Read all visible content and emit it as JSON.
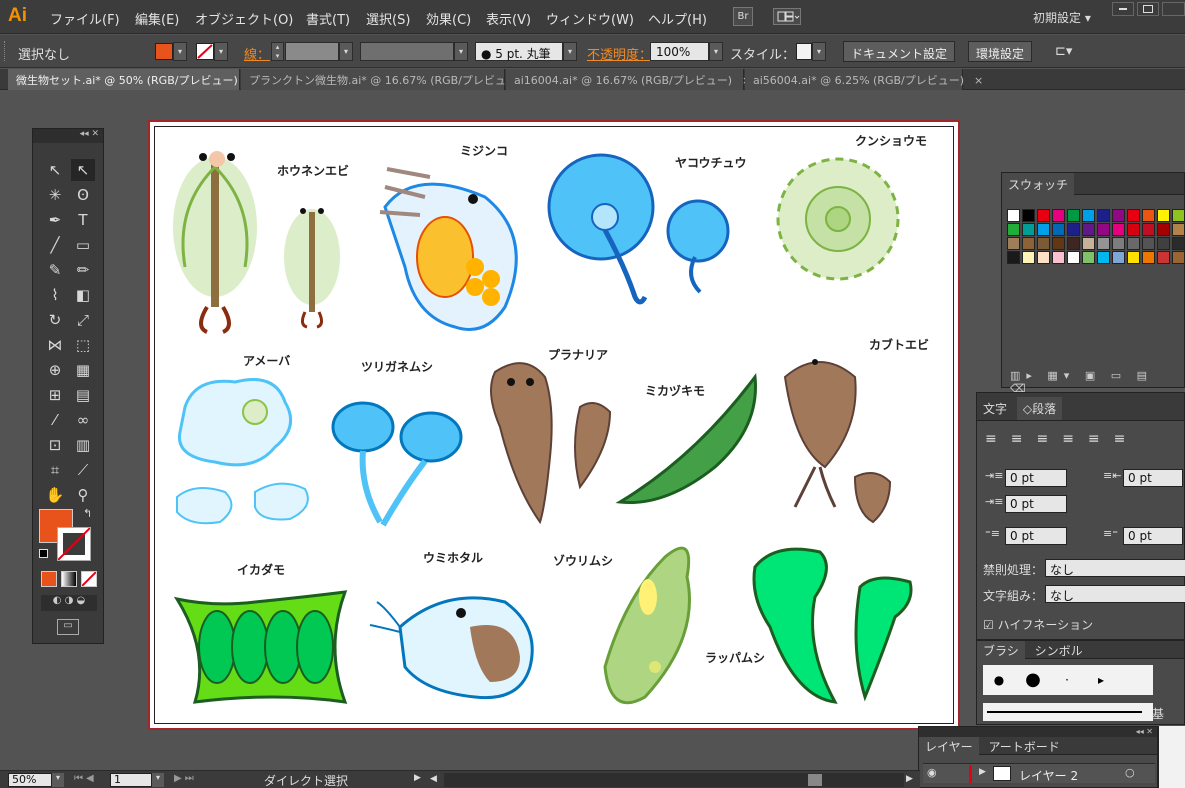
{
  "menubar": {
    "logo": "Ai",
    "items": [
      "ファイル(F)",
      "編集(E)",
      "オブジェクト(O)",
      "書式(T)",
      "選択(S)",
      "効果(C)",
      "表示(V)",
      "ウィンドウ(W)",
      "ヘルプ(H)"
    ],
    "bridge_label": "Br",
    "workspace": "初期設定"
  },
  "control": {
    "selection": "選択なし",
    "stroke_label": "線：",
    "brush": "● 5 pt. 丸筆",
    "opacity_label": "不透明度：",
    "opacity_value": "100%",
    "style_label": "スタイル：",
    "doc_settings": "ドキュメント設定",
    "prefs": "環境設定"
  },
  "tabs": [
    {
      "label": "微生物セット.ai* @ 50% (RGB/プレビュー)",
      "close": "×"
    },
    {
      "label": "プランクトン微生物.ai* @ 16.67% (RGB/プレビュー)",
      "close": "×"
    },
    {
      "label": "ai16004.ai* @ 16.67% (RGB/プレビュー)",
      "close": "×"
    },
    {
      "label": "ai56004.ai* @ 6.25% (RGB/プレビュー)",
      "close": "×"
    }
  ],
  "artboard_labels": {
    "houneneb": "ホウネンエビ",
    "mijinko": "ミジンコ",
    "yakouchu": "ヤコウチュウ",
    "kunshoumo": "クンショウモ",
    "ameba": "アメーバ",
    "tsuriganemushi": "ツリガネムシ",
    "planaria": "プラナリア",
    "mikazukimo": "ミカヅキモ",
    "kabutoebi": "カブトエビ",
    "ikadamo": "イカダモ",
    "umihotaru": "ウミホタル",
    "zourimushi": "ゾウリムシ",
    "rappamushi": "ラッパムシ"
  },
  "swatch_panel": {
    "title": "スウォッチ",
    "colors": [
      "#ffffff",
      "#000000",
      "#e60012",
      "#e4007f",
      "#009944",
      "#00a0e9",
      "#1d2088",
      "#920783",
      "#e60012",
      "#ea5514",
      "#fff100",
      "#8fc31f",
      "#22ac38",
      "#009e96",
      "#00a0e9",
      "#0068b7",
      "#1d2088",
      "#601986",
      "#920783",
      "#e4007f",
      "#d7000f",
      "#c30d23",
      "#a40000",
      "#b28247",
      "#9e7e5a",
      "#8c6239",
      "#7d5a36",
      "#603813",
      "#3e2723",
      "#c7b299",
      "#949494",
      "#7d7d7d",
      "#696969",
      "#545454",
      "#404040",
      "#2b2b2b",
      "#1a1a1a",
      "#fff3b8",
      "#fde0c5",
      "#f9c1cf",
      "#ffffff",
      "#80c269",
      "#00b7ee",
      "#7fa7d4",
      "#ffe000",
      "#ee7700",
      "#cc3333",
      "#996633"
    ]
  },
  "text_panel": {
    "tabs": [
      "文字",
      "段落"
    ],
    "indent_left": "0 pt",
    "indent_right": "0 pt",
    "first_line": "0 pt",
    "space_before": "0 pt",
    "space_after": "0 pt",
    "kinsoku_label": "禁則処理：",
    "kinsoku_value": "なし",
    "mojigumi_label": "文字組み：",
    "mojigumi_value": "なし",
    "hyphenation": "ハイフネーション"
  },
  "brush_panel": {
    "tabs": [
      "ブラシ",
      "シンボル"
    ],
    "basic_label": "基"
  },
  "layers_panel": {
    "tabs": [
      "レイヤー",
      "アートボード"
    ],
    "layer_name": "レイヤー 2"
  },
  "status": {
    "zoom": "50%",
    "page": "1",
    "tool": "ダイレクト選択"
  },
  "colors": {
    "fill": "#e8531b",
    "accent": "#f39200",
    "artboard_border": "#a3262a"
  }
}
